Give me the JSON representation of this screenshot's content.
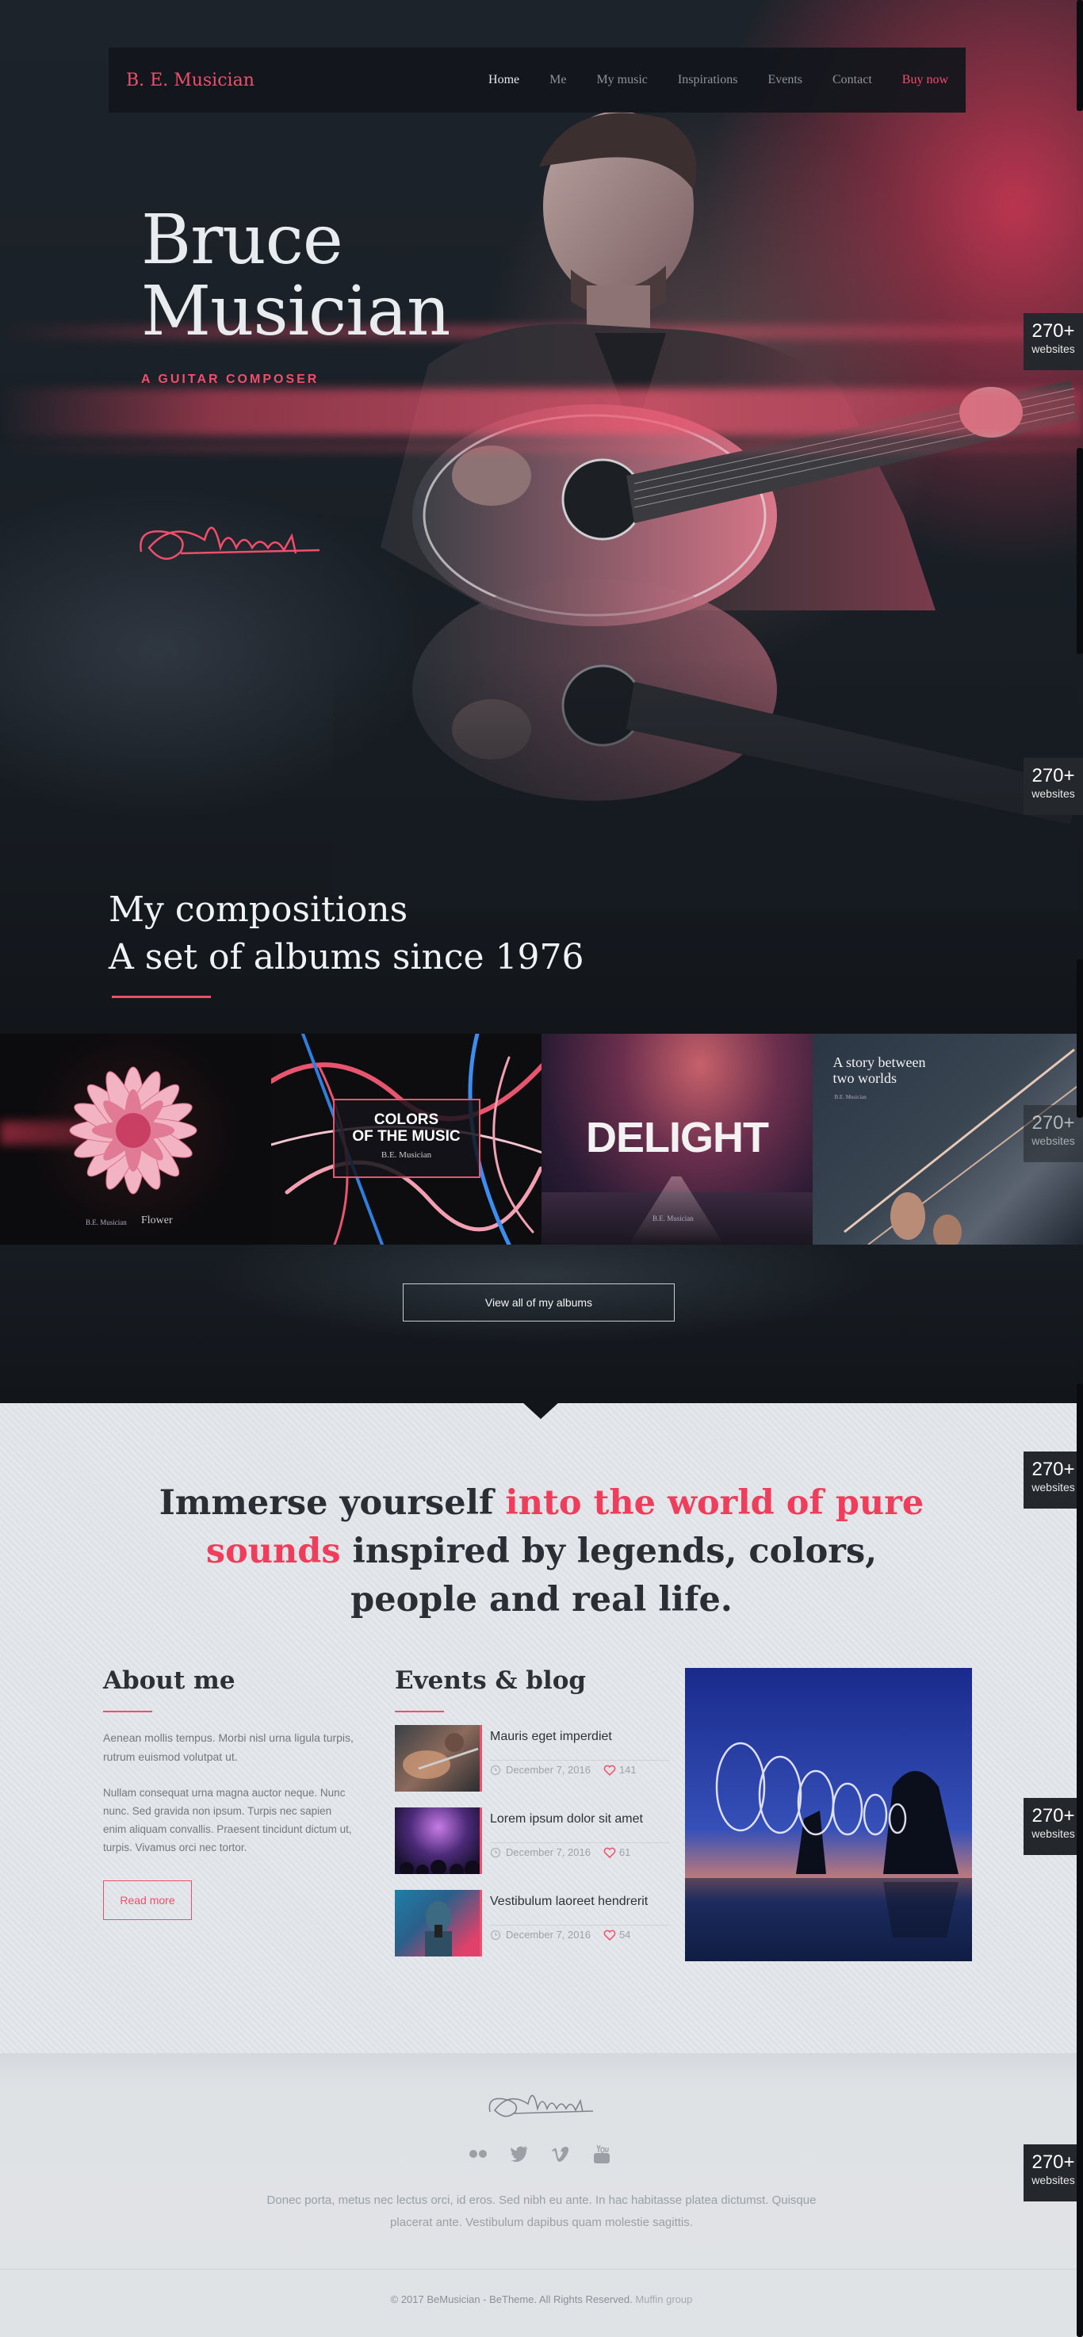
{
  "nav": {
    "logo": "B. E. Musician",
    "items": [
      "Home",
      "Me",
      "My music",
      "Inspirations",
      "Events",
      "Contact",
      "Buy now"
    ]
  },
  "hero": {
    "title_line1": "Bruce",
    "title_line2": "Musician",
    "subtitle": "A GUITAR COMPOSER"
  },
  "compositions": {
    "line1": "My compositions",
    "line2": "A set of albums since 1976"
  },
  "albums": [
    {
      "title": "Flower",
      "artist": "B.E. Musician"
    },
    {
      "title_line1": "COLORS",
      "title_line2": "OF THE MUSIC",
      "artist": "B.E. Musician"
    },
    {
      "title": "DELIGHT",
      "artist": "B.E. Musician"
    },
    {
      "title_line1": "A story between",
      "title_line2": "two worlds",
      "artist": "B.E. Musician"
    }
  ],
  "view_albums_button": "View all of my albums",
  "intro": {
    "part1": "Immerse yourself ",
    "highlight": "into the world of pure sounds",
    "part2": " inspired by legends, colors, people and real life."
  },
  "about": {
    "title": "About me",
    "p1": "Aenean mollis tempus. Morbi nisl urna ligula turpis, rutrum euismod volutpat ut.",
    "p2": "Nullam consequat urna magna auctor neque. Nunc nunc. Sed gravida non ipsum. Turpis nec sapien enim aliquam convallis. Praesent tincidunt dictum ut, turpis. Vivamus orci nec tortor.",
    "button": "Read more"
  },
  "blog": {
    "title": "Events & blog",
    "posts": [
      {
        "title": "Mauris eget imperdiet",
        "date": "December 7, 2016",
        "likes": "141"
      },
      {
        "title": "Lorem ipsum dolor sit amet",
        "date": "December 7, 2016",
        "likes": "61"
      },
      {
        "title": "Vestibulum laoreet hendrerit",
        "date": "December 7, 2016",
        "likes": "54"
      }
    ]
  },
  "footer": {
    "text": "Donec porta, metus nec lectus orci, id eros. Sed nibh eu ante. In hac habitasse platea dictumst. Quisque placerat ante. Vestibulum dapibus quam molestie sagittis.",
    "copyright": "© 2017 BeMusician - BeTheme. All Rights Reserved. ",
    "brand": "Muffin group",
    "socials": [
      "flickr-icon",
      "twitter-icon",
      "vimeo-icon",
      "youtube-icon"
    ]
  },
  "badge": {
    "num": "270+",
    "label": "websites"
  },
  "colors": {
    "accent": "#ef4f6a",
    "dark": "#15191e",
    "light_bg": "#dfe2e6"
  }
}
